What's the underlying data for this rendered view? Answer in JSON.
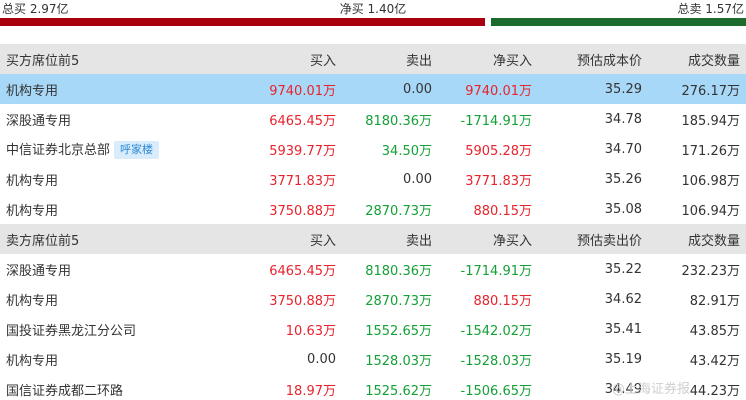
{
  "summary": {
    "total_buy": "总买 2.97亿",
    "net_buy": "净买 1.40亿",
    "total_sell": "总卖 1.57亿"
  },
  "colors": {
    "buy_bar": "#a8000c",
    "sell_bar": "#1c6b2e",
    "highlight_row": "#a8d8f7"
  },
  "bar": {
    "buy_fraction": 0.654,
    "sell_fraction": 0.346
  },
  "buy_header": [
    "买方席位前5",
    "买入",
    "卖出",
    "净买入",
    "预估成本价",
    "成交数量"
  ],
  "buy_rows": [
    {
      "name": "机构专用",
      "buy": "9740.01万",
      "sell": "0.00",
      "net": "9740.01万",
      "price": "35.29",
      "volume": "276.17万"
    },
    {
      "name": "深股通专用",
      "buy": "6465.45万",
      "sell": "8180.36万",
      "net": "-1714.91万",
      "price": "34.78",
      "volume": "185.94万"
    },
    {
      "name": "中信证券北京总部",
      "tag": "呼家楼",
      "buy": "5939.77万",
      "sell": "34.50万",
      "net": "5905.28万",
      "price": "34.70",
      "volume": "171.26万"
    },
    {
      "name": "机构专用",
      "buy": "3771.83万",
      "sell": "0.00",
      "net": "3771.83万",
      "price": "35.26",
      "volume": "106.98万"
    },
    {
      "name": "机构专用",
      "buy": "3750.88万",
      "sell": "2870.73万",
      "net": "880.15万",
      "price": "35.08",
      "volume": "106.94万"
    }
  ],
  "sell_header": [
    "卖方席位前5",
    "买入",
    "卖出",
    "净买入",
    "预估卖出价",
    "成交数量"
  ],
  "sell_rows": [
    {
      "name": "深股通专用",
      "buy": "6465.45万",
      "sell": "8180.36万",
      "net": "-1714.91万",
      "price": "35.22",
      "volume": "232.23万"
    },
    {
      "name": "机构专用",
      "buy": "3750.88万",
      "sell": "2870.73万",
      "net": "880.15万",
      "price": "34.62",
      "volume": "82.91万"
    },
    {
      "name": "国投证券黑龙江分公司",
      "buy": "10.63万",
      "sell": "1552.65万",
      "net": "-1542.02万",
      "price": "35.41",
      "volume": "43.85万"
    },
    {
      "name": "机构专用",
      "buy": "0.00",
      "sell": "1528.03万",
      "net": "-1528.03万",
      "price": "35.19",
      "volume": "43.42万"
    },
    {
      "name": "国信证券成都二环路",
      "buy": "18.97万",
      "sell": "1525.62万",
      "net": "-1506.65万",
      "price": "34.49",
      "volume": "44.23万"
    }
  ],
  "watermark": "@上海证券报"
}
